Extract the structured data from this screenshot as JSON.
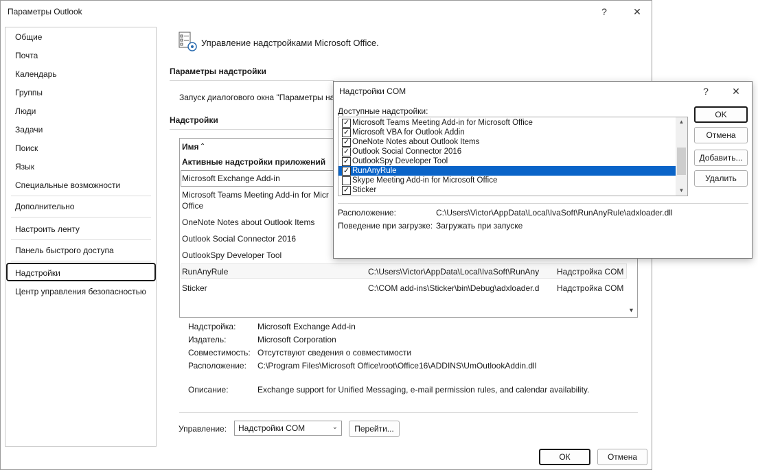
{
  "main_window": {
    "title": "Параметры Outlook",
    "help": "?",
    "close": "✕"
  },
  "nav": {
    "items": [
      {
        "label": "Общие"
      },
      {
        "label": "Почта"
      },
      {
        "label": "Календарь"
      },
      {
        "label": "Группы"
      },
      {
        "label": "Люди"
      },
      {
        "label": "Задачи"
      },
      {
        "label": "Поиск"
      },
      {
        "label": "Язык"
      },
      {
        "label": "Специальные возможности"
      },
      {
        "label": "Дополнительно"
      },
      {
        "label": "Настроить ленту"
      },
      {
        "label": "Панель быстрого доступа"
      },
      {
        "label": "Надстройки"
      },
      {
        "label": "Центр управления безопасностью"
      }
    ],
    "selected_index": 12
  },
  "content": {
    "header_title": "Управление надстройками Microsoft Office.",
    "addin_params_title": "Параметры надстройки",
    "addin_params_text": "Запуск диалогового окна \"Параметры на",
    "addins_title": "Надстройки",
    "table": {
      "col_name": "Имя ˆ",
      "group_active": "Активные надстройки приложений",
      "rows": [
        {
          "name": "Microsoft Exchange Add-in",
          "location": "",
          "type": ""
        },
        {
          "name": "Microsoft Teams Meeting Add-in for Micr",
          "name2": "Office",
          "location": "",
          "type": ""
        },
        {
          "name": "OneNote Notes about Outlook Items",
          "location": "",
          "type": ""
        },
        {
          "name": "Outlook Social Connector 2016",
          "location": "",
          "type": ""
        },
        {
          "name": "OutlookSpy Developer Tool",
          "location": "",
          "type": ""
        },
        {
          "name": "RunAnyRule",
          "location": "C:\\Users\\Victor\\AppData\\Local\\IvaSoft\\RunAny",
          "type": "Надстройка COM"
        },
        {
          "name": "Sticker",
          "location": "C:\\COM add-ins\\Sticker\\bin\\Debug\\adxloader.d",
          "type": "Надстройка COM"
        }
      ]
    },
    "details": {
      "addin_label": "Надстройка:",
      "addin_value": "Microsoft Exchange Add-in",
      "publisher_label": "Издатель:",
      "publisher_value": "Microsoft Corporation",
      "compat_label": "Совместимость:",
      "compat_value": "Отсутствуют сведения о совместимости",
      "location_label": "Расположение:",
      "location_value": "C:\\Program Files\\Microsoft Office\\root\\Office16\\ADDINS\\UmOutlookAddin.dll",
      "desc_label": "Описание:",
      "desc_value": "Exchange support for Unified Messaging, e-mail permission rules, and calendar availability."
    },
    "manage_label": "Управление:",
    "manage_value": "Надстройки COM",
    "go_button": "Перейти...",
    "ok_button": "ОК",
    "cancel_button": "Отмена"
  },
  "com_dialog": {
    "title": "Надстройки COM",
    "help": "?",
    "close": "✕",
    "available_label": "Доступные надстройки:",
    "items": [
      {
        "label": "Microsoft Teams Meeting Add-in for Microsoft Office",
        "checked": true
      },
      {
        "label": "Microsoft VBA for Outlook Addin",
        "checked": true
      },
      {
        "label": "OneNote Notes about Outlook Items",
        "checked": true
      },
      {
        "label": "Outlook Social Connector 2016",
        "checked": true
      },
      {
        "label": "OutlookSpy Developer Tool",
        "checked": true
      },
      {
        "label": "RunAnyRule",
        "checked": true,
        "selected": true
      },
      {
        "label": "Skype Meeting Add-in for Microsoft Office",
        "checked": false
      },
      {
        "label": "Sticker",
        "checked": true
      }
    ],
    "location_label": "Расположение:",
    "location_value": "C:\\Users\\Victor\\AppData\\Local\\IvaSoft\\RunAnyRule\\adxloader.dll",
    "load_label": "Поведение при загрузке:",
    "load_value": "Загружать при запуске",
    "ok_button": "OK",
    "cancel_button": "Отмена",
    "add_button": "Добавить...",
    "remove_button": "Удалить"
  },
  "colors": {
    "selection": "#0a64c8",
    "border": "#a0a0a0"
  }
}
